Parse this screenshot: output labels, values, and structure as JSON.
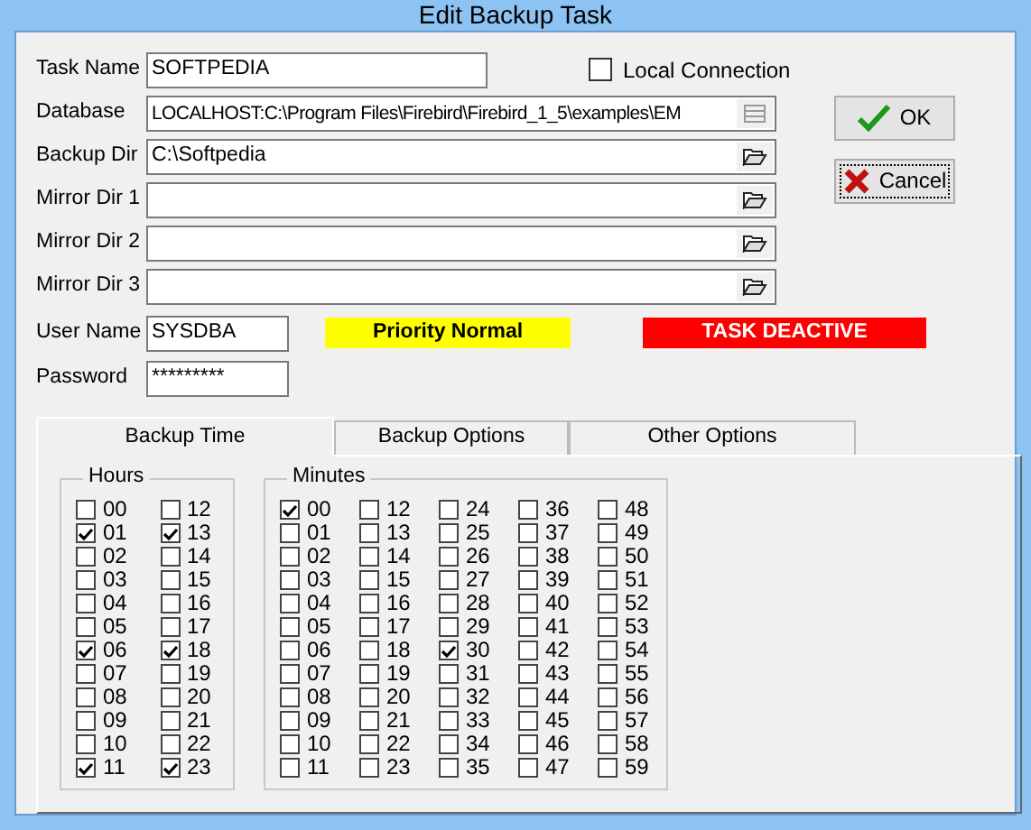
{
  "window": {
    "title": "Edit Backup Task"
  },
  "fields": [
    {
      "label": "Task Name",
      "value": "SOFTPEDIA",
      "kind": "short"
    },
    {
      "label": "Database",
      "value": "LOCALHOST:C:\\Program Files\\Firebird\\Firebird_1_5\\examples\\EM",
      "kind": "list"
    },
    {
      "label": "Backup Dir",
      "value": "C:\\Softpedia",
      "kind": "folder"
    },
    {
      "label": "Mirror Dir 1",
      "kind": "folder"
    },
    {
      "label": "Mirror Dir 2",
      "kind": "folder"
    },
    {
      "label": "Mirror Dir 3",
      "kind": "folder"
    }
  ],
  "local_connection": {
    "label": "Local Connection",
    "checked": false
  },
  "buttons": [
    {
      "label": "OK",
      "kind": "ok"
    },
    {
      "label": "Cancel",
      "kind": "cancel"
    }
  ],
  "user_name": {
    "label": "User Name",
    "value": "SYSDBA"
  },
  "password": {
    "label": "Password",
    "value": "*********"
  },
  "status_badges": [
    {
      "text": "Priority Normal",
      "color": "#ffff00"
    },
    {
      "text": "TASK DEACTIVE",
      "color": "#ff0000"
    }
  ],
  "tabs": [
    {
      "label": "Backup Time",
      "selected": true
    },
    {
      "label": "Backup Options",
      "selected": false
    },
    {
      "label": "Other Options",
      "selected": false
    }
  ],
  "hours": {
    "title": "Hours",
    "items": [
      {
        "label": "00",
        "checked": false
      },
      {
        "label": "01",
        "checked": true
      },
      {
        "label": "02",
        "checked": false
      },
      {
        "label": "03",
        "checked": false
      },
      {
        "label": "04",
        "checked": false
      },
      {
        "label": "05",
        "checked": false
      },
      {
        "label": "06",
        "checked": true
      },
      {
        "label": "07",
        "checked": false
      },
      {
        "label": "08",
        "checked": false
      },
      {
        "label": "09",
        "checked": false
      },
      {
        "label": "10",
        "checked": false
      },
      {
        "label": "11",
        "checked": true
      },
      {
        "label": "12",
        "checked": false
      },
      {
        "label": "13",
        "checked": true
      },
      {
        "label": "14",
        "checked": false
      },
      {
        "label": "15",
        "checked": false
      },
      {
        "label": "16",
        "checked": false
      },
      {
        "label": "17",
        "checked": false
      },
      {
        "label": "18",
        "checked": true
      },
      {
        "label": "19",
        "checked": false
      },
      {
        "label": "20",
        "checked": false
      },
      {
        "label": "21",
        "checked": false
      },
      {
        "label": "22",
        "checked": false
      },
      {
        "label": "23",
        "checked": true
      }
    ]
  },
  "minutes": {
    "title": "Minutes",
    "items": [
      {
        "label": "00",
        "checked": true
      },
      {
        "label": "01",
        "checked": false
      },
      {
        "label": "02",
        "checked": false
      },
      {
        "label": "03",
        "checked": false
      },
      {
        "label": "04",
        "checked": false
      },
      {
        "label": "05",
        "checked": false
      },
      {
        "label": "06",
        "checked": false
      },
      {
        "label": "07",
        "checked": false
      },
      {
        "label": "08",
        "checked": false
      },
      {
        "label": "09",
        "checked": false
      },
      {
        "label": "10",
        "checked": false
      },
      {
        "label": "11",
        "checked": false
      },
      {
        "label": "12",
        "checked": false
      },
      {
        "label": "13",
        "checked": false
      },
      {
        "label": "14",
        "checked": false
      },
      {
        "label": "15",
        "checked": false
      },
      {
        "label": "16",
        "checked": false
      },
      {
        "label": "17",
        "checked": false
      },
      {
        "label": "18",
        "checked": false
      },
      {
        "label": "19",
        "checked": false
      },
      {
        "label": "20",
        "checked": false
      },
      {
        "label": "21",
        "checked": false
      },
      {
        "label": "22",
        "checked": false
      },
      {
        "label": "23",
        "checked": false
      },
      {
        "label": "24",
        "checked": false
      },
      {
        "label": "25",
        "checked": false
      },
      {
        "label": "26",
        "checked": false
      },
      {
        "label": "27",
        "checked": false
      },
      {
        "label": "28",
        "checked": false
      },
      {
        "label": "29",
        "checked": false
      },
      {
        "label": "30",
        "checked": true
      },
      {
        "label": "31",
        "checked": false
      },
      {
        "label": "32",
        "checked": false
      },
      {
        "label": "33",
        "checked": false
      },
      {
        "label": "34",
        "checked": false
      },
      {
        "label": "35",
        "checked": false
      },
      {
        "label": "36",
        "checked": false
      },
      {
        "label": "37",
        "checked": false
      },
      {
        "label": "38",
        "checked": false
      },
      {
        "label": "39",
        "checked": false
      },
      {
        "label": "40",
        "checked": false
      },
      {
        "label": "41",
        "checked": false
      },
      {
        "label": "42",
        "checked": false
      },
      {
        "label": "43",
        "checked": false
      },
      {
        "label": "44",
        "checked": false
      },
      {
        "label": "45",
        "checked": false
      },
      {
        "label": "46",
        "checked": false
      },
      {
        "label": "47",
        "checked": false
      },
      {
        "label": "48",
        "checked": false
      },
      {
        "label": "49",
        "checked": false
      },
      {
        "label": "50",
        "checked": false
      },
      {
        "label": "51",
        "checked": false
      },
      {
        "label": "52",
        "checked": false
      },
      {
        "label": "53",
        "checked": false
      },
      {
        "label": "54",
        "checked": false
      },
      {
        "label": "55",
        "checked": false
      },
      {
        "label": "56",
        "checked": false
      },
      {
        "label": "57",
        "checked": false
      },
      {
        "label": "58",
        "checked": false
      },
      {
        "label": "59",
        "checked": false
      }
    ]
  }
}
